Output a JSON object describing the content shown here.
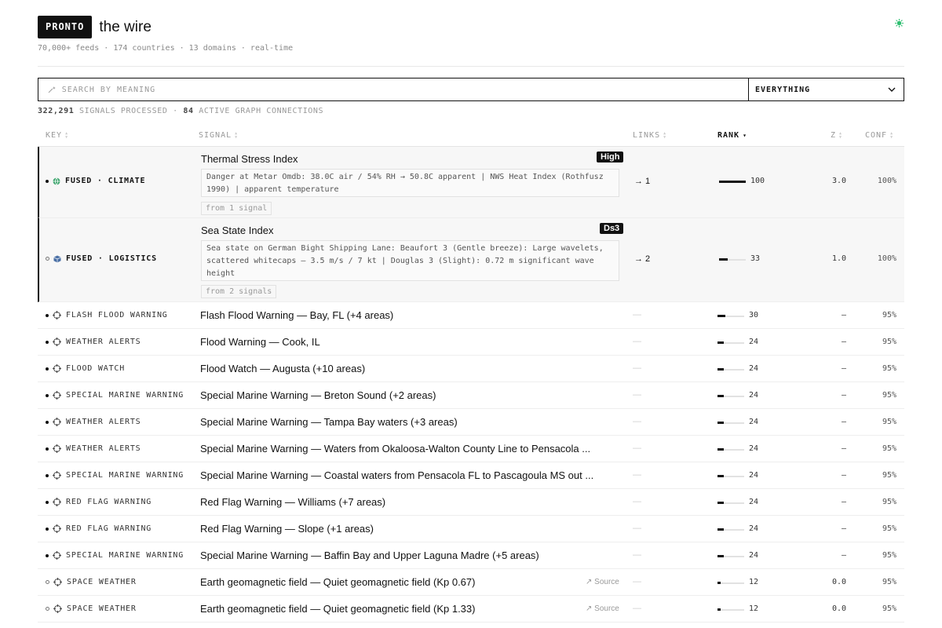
{
  "header": {
    "brand": "PRONTO",
    "title": "the wire",
    "subtitle": "70,000+ feeds · 174 countries · 13 domains · real-time"
  },
  "search": {
    "placeholder": "SEARCH BY MEANING",
    "filter_value": "EVERYTHING"
  },
  "stats": {
    "signals_count": "322,291",
    "signals_label": "SIGNALS PROCESSED",
    "sep": "·",
    "connections_count": "84",
    "connections_label": "ACTIVE GRAPH CONNECTIONS"
  },
  "columns": {
    "key": "KEY",
    "signal": "SIGNAL",
    "links": "LINKS",
    "rank": "RANK",
    "z": "Z",
    "conf": "CONF"
  },
  "colors": {
    "climate_icon": "#3aa36b",
    "logistics_icon": "#4a6fa5",
    "accent": "#111111",
    "status_dot": "#2fbf71"
  },
  "expanded_rows": [
    {
      "key": "FUSED · CLIMATE",
      "icon": "globe-icon",
      "title": "Thermal Stress Index",
      "badge": "High",
      "description": "Danger at Metar Omdb: 38.0C air / 54% RH → 50.8C apparent | NWS Heat Index (Rothfusz 1990) | apparent temperature",
      "from": "from 1 signal",
      "links": "→ 1",
      "rank": "100",
      "rank_fraction": 1.0,
      "z": "3.0",
      "conf": "100%"
    },
    {
      "key": "FUSED · LOGISTICS",
      "icon": "cube-icon",
      "title": "Sea State Index",
      "badge": "Ds3",
      "description": "Sea state on German Bight Shipping Lane: Beaufort 3 (Gentle breeze): Large wavelets, scattered whitecaps — 3.5 m/s / 7 kt | Douglas 3 (Slight): 0.72 m significant wave height",
      "from": "from 2 signals",
      "links": "→ 2",
      "rank": "33",
      "rank_fraction": 0.33,
      "z": "1.0",
      "conf": "100%"
    }
  ],
  "rows": [
    {
      "key": "FLASH FLOOD WARNING",
      "title": "Flash Flood Warning — Bay, FL (+4 areas)",
      "source": "",
      "links": "—",
      "rank": "30",
      "rank_fraction": 0.3,
      "z": "—",
      "conf": "95%",
      "hollow": false
    },
    {
      "key": "WEATHER ALERTS",
      "title": "Flood Warning — Cook, IL",
      "source": "",
      "links": "—",
      "rank": "24",
      "rank_fraction": 0.24,
      "z": "—",
      "conf": "95%",
      "hollow": false
    },
    {
      "key": "FLOOD WATCH",
      "title": "Flood Watch — Augusta (+10 areas)",
      "source": "",
      "links": "—",
      "rank": "24",
      "rank_fraction": 0.24,
      "z": "—",
      "conf": "95%",
      "hollow": false
    },
    {
      "key": "SPECIAL MARINE WARNING",
      "title": "Special Marine Warning — Breton Sound (+2 areas)",
      "source": "",
      "links": "—",
      "rank": "24",
      "rank_fraction": 0.24,
      "z": "—",
      "conf": "95%",
      "hollow": false
    },
    {
      "key": "WEATHER ALERTS",
      "title": "Special Marine Warning — Tampa Bay waters (+3 areas)",
      "source": "",
      "links": "—",
      "rank": "24",
      "rank_fraction": 0.24,
      "z": "—",
      "conf": "95%",
      "hollow": false
    },
    {
      "key": "WEATHER ALERTS",
      "title": "Special Marine Warning — Waters from Okaloosa-Walton County Line to Pensacola ...",
      "source": "",
      "links": "—",
      "rank": "24",
      "rank_fraction": 0.24,
      "z": "—",
      "conf": "95%",
      "hollow": false
    },
    {
      "key": "SPECIAL MARINE WARNING",
      "title": "Special Marine Warning — Coastal waters from Pensacola FL to Pascagoula MS out ...",
      "source": "",
      "links": "—",
      "rank": "24",
      "rank_fraction": 0.24,
      "z": "—",
      "conf": "95%",
      "hollow": false
    },
    {
      "key": "RED FLAG WARNING",
      "title": "Red Flag Warning — Williams (+7 areas)",
      "source": "",
      "links": "—",
      "rank": "24",
      "rank_fraction": 0.24,
      "z": "—",
      "conf": "95%",
      "hollow": false
    },
    {
      "key": "RED FLAG WARNING",
      "title": "Red Flag Warning — Slope (+1 areas)",
      "source": "",
      "links": "—",
      "rank": "24",
      "rank_fraction": 0.24,
      "z": "—",
      "conf": "95%",
      "hollow": false
    },
    {
      "key": "SPECIAL MARINE WARNING",
      "title": "Special Marine Warning — Baffin Bay and Upper Laguna Madre (+5 areas)",
      "source": "",
      "links": "—",
      "rank": "24",
      "rank_fraction": 0.24,
      "z": "—",
      "conf": "95%",
      "hollow": false
    },
    {
      "key": "SPACE WEATHER",
      "title": "Earth geomagnetic field — Quiet geomagnetic field (Kp 0.67)",
      "source": "↗ Source",
      "links": "—",
      "rank": "12",
      "rank_fraction": 0.12,
      "z": "0.0",
      "conf": "95%",
      "hollow": true
    },
    {
      "key": "SPACE WEATHER",
      "title": "Earth geomagnetic field — Quiet geomagnetic field (Kp 1.33)",
      "source": "↗ Source",
      "links": "—",
      "rank": "12",
      "rank_fraction": 0.12,
      "z": "0.0",
      "conf": "95%",
      "hollow": true
    }
  ]
}
